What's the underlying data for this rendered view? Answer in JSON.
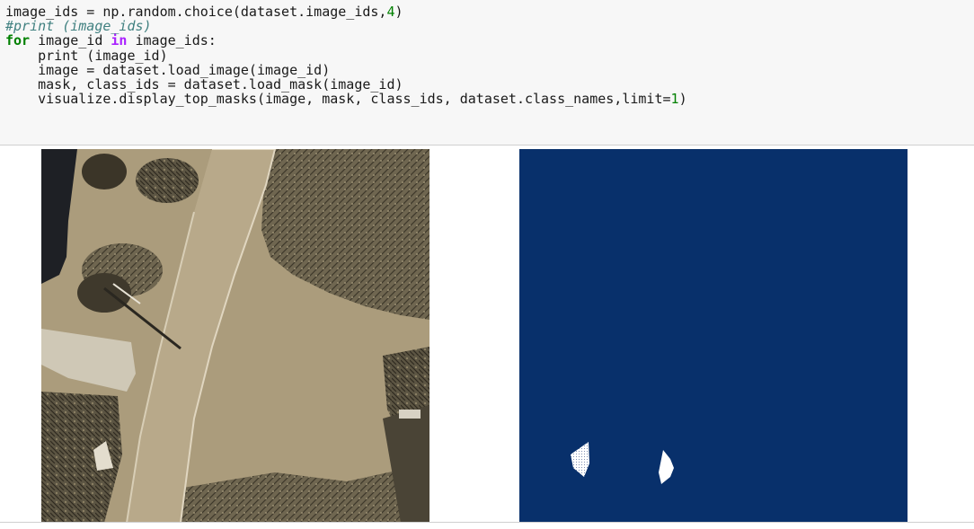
{
  "code_cell": {
    "lines": [
      "image_ids = np.random.choice(dataset.image_ids,4)",
      "#print (image_ids)",
      "for image_id in image_ids:",
      "    print (image_id)",
      "    image = dataset.load_image(image_id)",
      "    mask, class_ids = dataset.load_mask(image_id)",
      "    visualize.display_top_masks(image, mask, class_ids, dataset.class_names,limit=1)"
    ]
  },
  "output": {
    "left_panel": "aerial-photo",
    "right_panel": "mask-visualization",
    "colors": {
      "mask_background": "#08306b",
      "mask_foreground": "#ffffff",
      "photo_tone": "#a89a78"
    }
  }
}
